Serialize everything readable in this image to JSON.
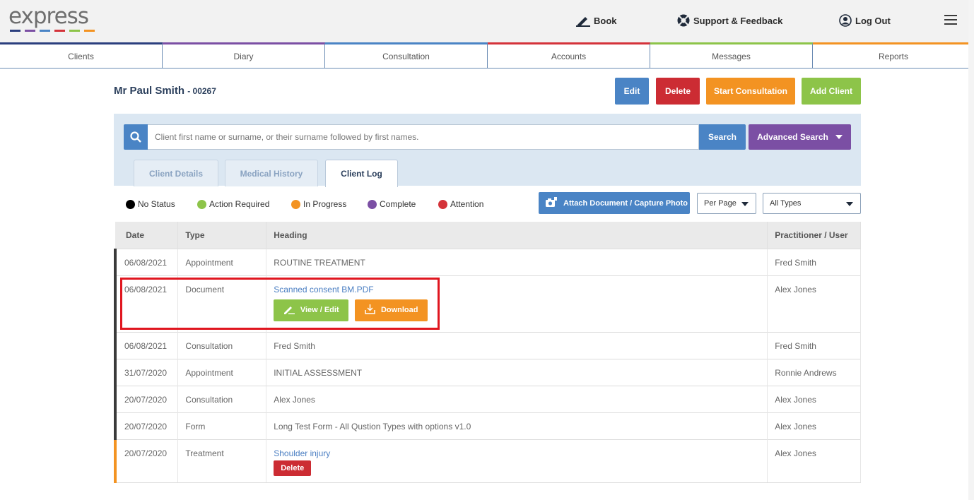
{
  "header": {
    "logo_text": "express",
    "logo_colors": [
      "#2b3f7e",
      "#7b4fa4",
      "#4a84c5",
      "#d4333a",
      "#8dc449",
      "#f39322"
    ],
    "book_label": "Book",
    "support_label": "Support & Feedback",
    "logout_label": "Log Out"
  },
  "nav": {
    "items": [
      {
        "label": "Clients",
        "color": "#2b3f7e"
      },
      {
        "label": "Diary",
        "color": "#7b4fa4"
      },
      {
        "label": "Consultation",
        "color": "#4a84c5"
      },
      {
        "label": "Accounts",
        "color": "#d4333a"
      },
      {
        "label": "Messages",
        "color": "#8dc449"
      },
      {
        "label": "Reports",
        "color": "#f39322"
      }
    ]
  },
  "client": {
    "name": "Mr Paul Smith",
    "number": "- 00267"
  },
  "actions": {
    "edit": "Edit",
    "delete": "Delete",
    "start_consultation": "Start Consultation",
    "add_client": "Add Client"
  },
  "search": {
    "placeholder": "Client first name or surname, or their surname followed by first names.",
    "button": "Search",
    "advanced": "Advanced Search"
  },
  "tabs": [
    "Client Details",
    "Medical History",
    "Client Log"
  ],
  "legend": [
    {
      "label": "No Status",
      "color": "#000000"
    },
    {
      "label": "Action Required",
      "color": "#8dc449"
    },
    {
      "label": "In Progress",
      "color": "#f39322"
    },
    {
      "label": "Complete",
      "color": "#7b4fa4"
    },
    {
      "label": "Attention",
      "color": "#d4333a"
    }
  ],
  "toolbar": {
    "attach": "Attach Document / Capture Photo",
    "per_page": "Per Page",
    "types": "All Types"
  },
  "table": {
    "headers": [
      "Date",
      "Type",
      "Heading",
      "Practitioner / User"
    ],
    "rows": [
      {
        "date": "06/08/2021",
        "type": "Appointment",
        "heading": "ROUTINE TREATMENT",
        "user": "Fred Smith"
      },
      {
        "date": "06/08/2021",
        "type": "Document",
        "heading": "Scanned consent BM.PDF",
        "user": "Alex Jones",
        "view_edit": "View / Edit",
        "download": "Download"
      },
      {
        "date": "06/08/2021",
        "type": "Consultation",
        "heading": "Fred Smith",
        "user": "Fred Smith"
      },
      {
        "date": "31/07/2020",
        "type": "Appointment",
        "heading": "INITIAL ASSESSMENT",
        "user": "Ronnie Andrews"
      },
      {
        "date": "20/07/2020",
        "type": "Consultation",
        "heading": "Alex Jones",
        "user": "Alex Jones"
      },
      {
        "date": "20/07/2020",
        "type": "Form",
        "heading": "Long Test Form - All Qustion Types with options v1.0",
        "user": "Alex Jones"
      },
      {
        "date": "20/07/2020",
        "type": "Treatment",
        "heading": "Shoulder injury",
        "user": "Alex Jones",
        "delete": "Delete"
      }
    ]
  }
}
